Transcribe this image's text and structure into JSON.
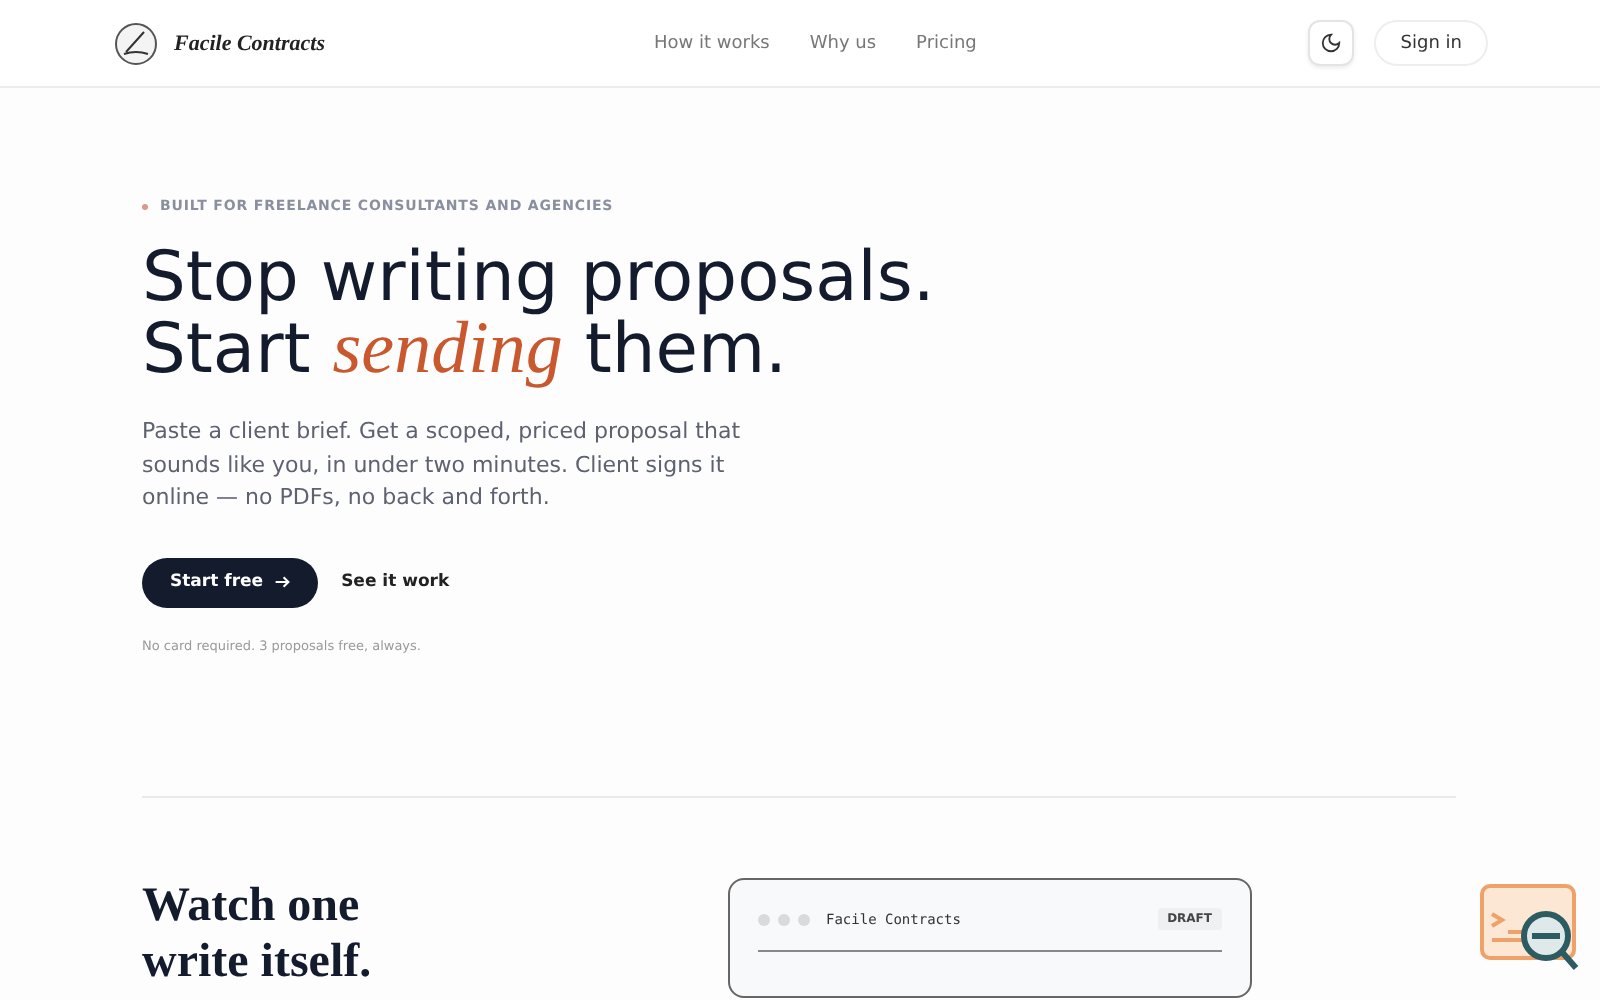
{
  "header": {
    "brand": "Facile Contracts",
    "nav": [
      "How it works",
      "Why us",
      "Pricing"
    ],
    "sign_in": "Sign in"
  },
  "hero": {
    "eyebrow": "BUILT FOR FREELANCE CONSULTANTS AND AGENCIES",
    "headline": [
      "Stop writing proposals.",
      "Start *sending* them."
    ],
    "lead": "Paste a client brief. Get a scoped, priced proposal that sounds like you, in under two minutes. Client signs it online — no PDFs, no back and forth.",
    "primary": "Start free",
    "secondary": "See it work",
    "note": "No card required. 3 proposals free, always."
  },
  "demo": {
    "heading": [
      "Watch one",
      "write itself."
    ],
    "window_title": "Facile Contracts",
    "badge": "DRAFT"
  }
}
